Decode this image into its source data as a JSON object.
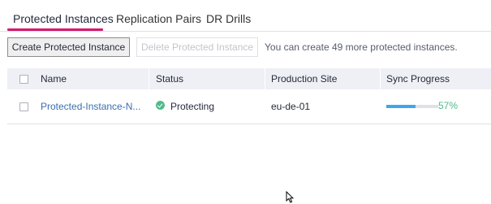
{
  "tabs": [
    {
      "label": "Protected Instances",
      "active": true
    },
    {
      "label": "Replication Pairs",
      "active": false
    },
    {
      "label": "DR Drills",
      "active": false
    }
  ],
  "toolbar": {
    "create_label": "Create Protected Instance",
    "delete_label": "Delete Protected Instance",
    "hint": "You can create 49 more protected instances."
  },
  "table": {
    "headers": [
      "Name",
      "Status",
      "Production Site",
      "Sync Progress"
    ],
    "rows": [
      {
        "name": "Protected-Instance-N...",
        "status": "Protecting",
        "production_site": "eu-de-01",
        "sync_progress_label": "57%",
        "sync_progress_fraction": 0.57
      }
    ]
  },
  "colors": {
    "active_tab_accent": "#d6196c",
    "status_ok": "#4ebb8b",
    "progress_fill": "#3ea6e9"
  }
}
